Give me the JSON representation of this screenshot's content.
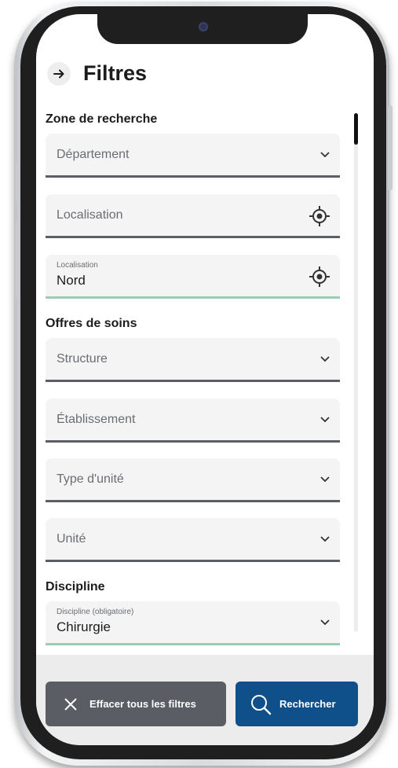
{
  "header": {
    "title": "Filtres",
    "back_icon": "arrow-right-icon"
  },
  "sections": {
    "zone": "Zone de recherche",
    "offres": "Offres de soins",
    "discipline": "Discipline"
  },
  "fields": {
    "departement": {
      "placeholder": "Département"
    },
    "localisation_empty": {
      "placeholder": "Localisation"
    },
    "localisation_filled": {
      "label": "Localisation",
      "value": "Nord"
    },
    "structure": {
      "placeholder": "Structure"
    },
    "etablissement": {
      "placeholder": "Établissement"
    },
    "type_unite": {
      "placeholder": "Type d'unité"
    },
    "unite": {
      "placeholder": "Unité"
    },
    "discipline": {
      "label": "Discipline (obligatoire)",
      "value": "Chirurgie"
    }
  },
  "footer": {
    "clear_label": "Effacer tous les filtres",
    "search_label": "Rechercher"
  },
  "colors": {
    "accent": "#0f4f8a",
    "filled_underline": "#9bcdb4",
    "clear_button": "#5a5d63"
  }
}
